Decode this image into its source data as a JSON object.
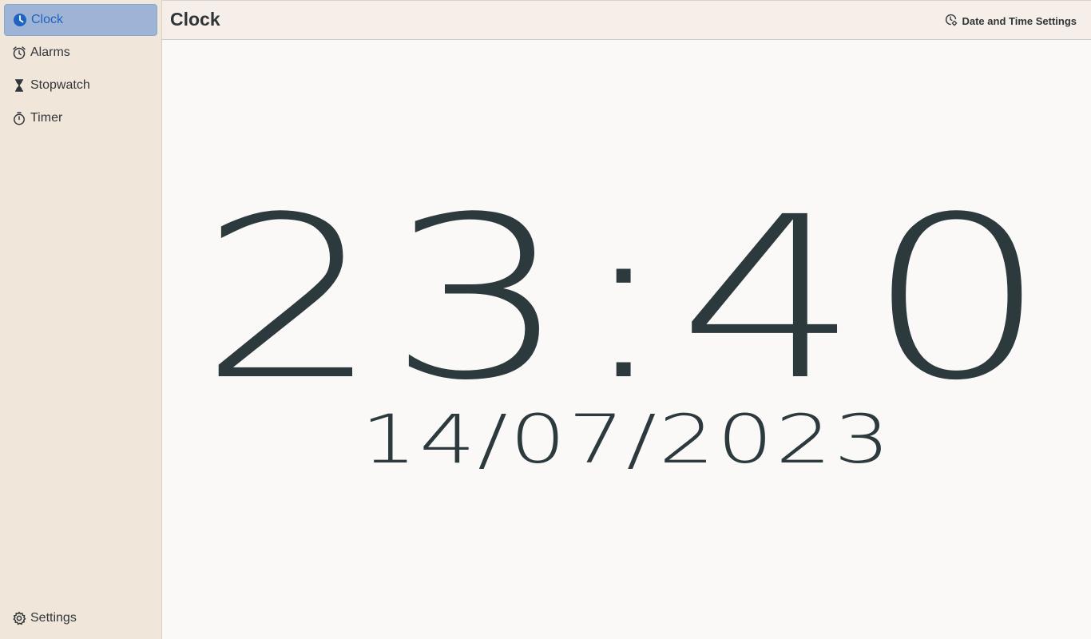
{
  "sidebar": {
    "items": [
      {
        "label": "Clock",
        "icon": "clock-icon"
      },
      {
        "label": "Alarms",
        "icon": "alarm-icon"
      },
      {
        "label": "Stopwatch",
        "icon": "hourglass-icon"
      },
      {
        "label": "Timer",
        "icon": "timer-icon"
      }
    ],
    "settings": {
      "label": "Settings",
      "icon": "gear-icon"
    }
  },
  "header": {
    "title": "Clock",
    "date_time_settings_label": "Date and Time Settings",
    "date_time_settings_icon": "clock-gear-icon"
  },
  "main": {
    "time": "23:40",
    "date": "14/07/2023"
  },
  "colors": {
    "accent": "#1f62bf",
    "active_bg": "#9db4d6",
    "sidebar_bg": "#f1e6da",
    "text": "#2c3a3d"
  }
}
